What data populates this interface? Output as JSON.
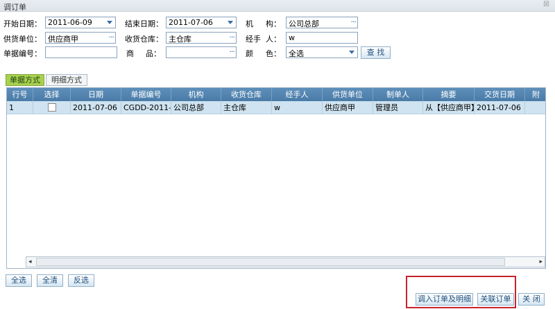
{
  "window": {
    "title": "调订单",
    "close_glyph": "☒"
  },
  "filters": {
    "start_date": {
      "label": "开始日期：",
      "value": "2011-06-09"
    },
    "end_date": {
      "label": "结束日期：",
      "value": "2011-07-06"
    },
    "org": {
      "label_a": "机",
      "label_b": "构：",
      "value": "公司总部"
    },
    "supplier": {
      "label": "供货单位：",
      "value": "供应商甲"
    },
    "warehouse": {
      "label": "收货仓库：",
      "value": "主仓库"
    },
    "handler": {
      "label_a": "经手",
      "label_b": "人：",
      "value": "w"
    },
    "doc_no": {
      "label": "单据编号：",
      "value": ""
    },
    "product": {
      "label_a": "商",
      "label_b": "品：",
      "value": ""
    },
    "color": {
      "label_a": "颜",
      "label_b": "色：",
      "value": "全选"
    },
    "search_label": "查 找",
    "picker_glyph": "···"
  },
  "tabs": [
    {
      "label": "单据方式",
      "active": true
    },
    {
      "label": "明细方式",
      "active": false
    }
  ],
  "grid": {
    "columns": [
      "行号",
      "选择",
      "日期",
      "单据编号",
      "机构",
      "收货仓库",
      "经手人",
      "供货单位",
      "制单人",
      "摘要",
      "交货日期",
      "附"
    ],
    "rows": [
      {
        "row_no": "1",
        "checked": false,
        "date": "2011-07-06",
        "doc_no": "CGDD-2011-",
        "org": "公司总部",
        "warehouse": "主仓库",
        "handler": "w",
        "supplier": "供应商甲",
        "creator": "管理员",
        "summary": "从【供应商甲】",
        "delivery_date": "2011-07-06",
        "extra": ""
      }
    ]
  },
  "scroll": {
    "left_glyph": "◂",
    "right_glyph": "▸"
  },
  "footer": {
    "select_all": "全选",
    "clear_all": "全清",
    "invert": "反选",
    "import_order_detail": "调入订单及明细",
    "link_order": "关联订单",
    "close": "关 闭"
  }
}
